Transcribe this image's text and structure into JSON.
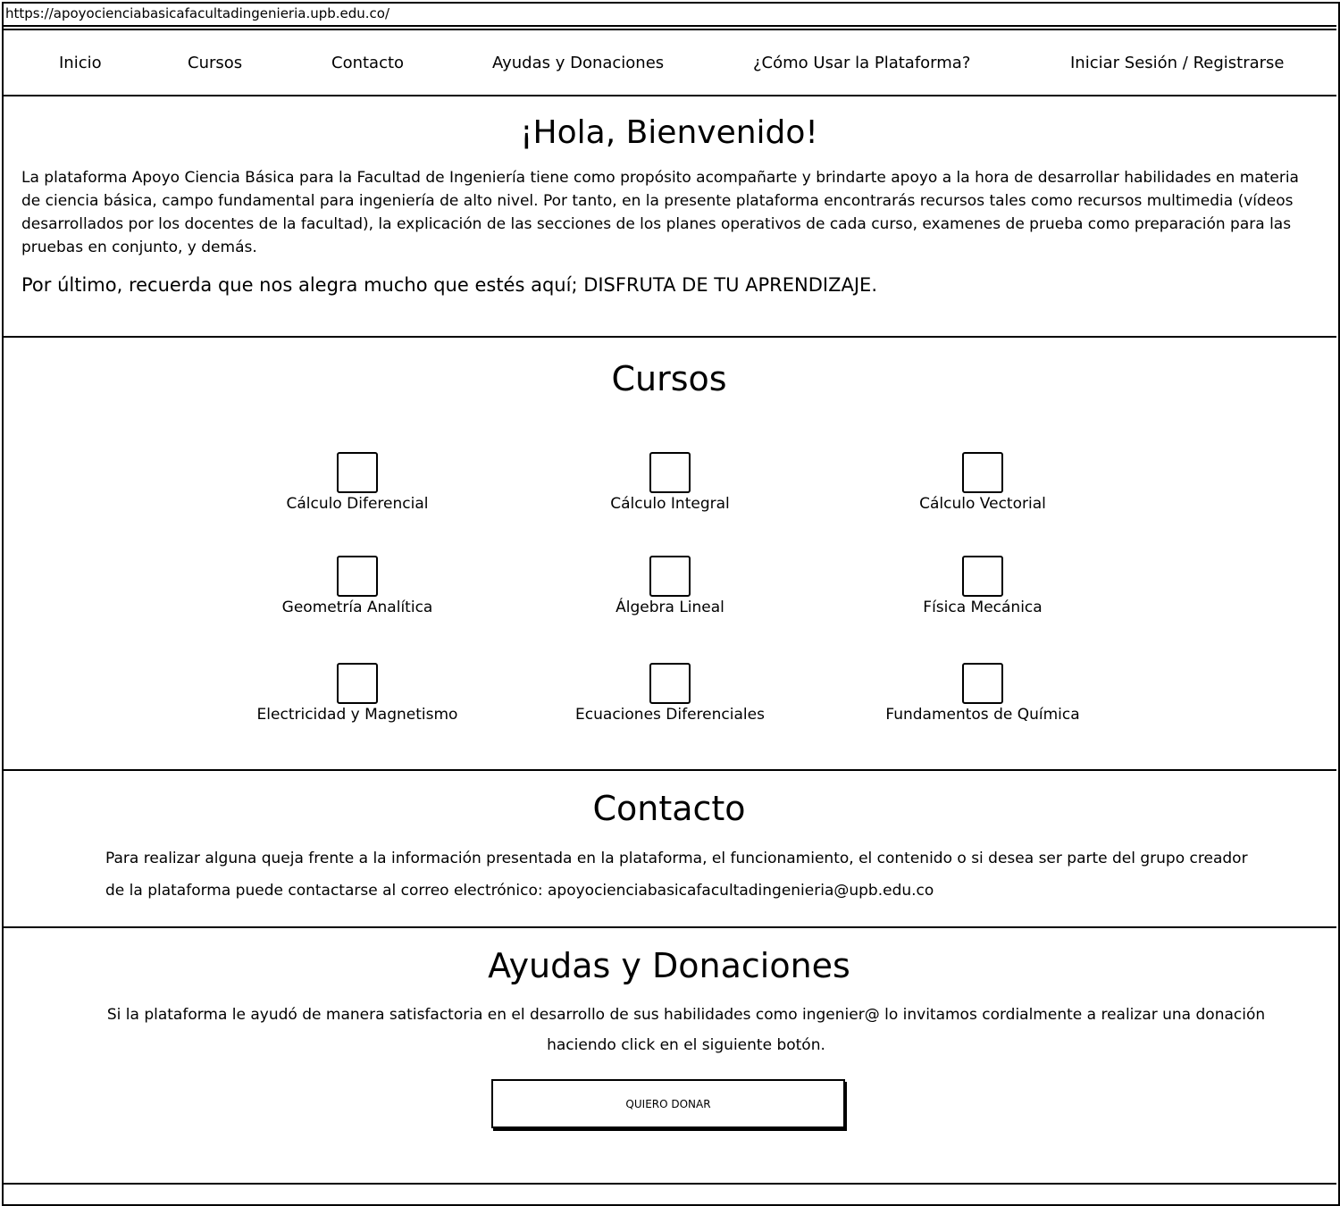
{
  "browser": {
    "url": "https://apoyocienciabasicafacultadingenieria.upb.edu.co/"
  },
  "nav": {
    "items": [
      {
        "label": "Inicio"
      },
      {
        "label": "Cursos"
      },
      {
        "label": "Contacto"
      },
      {
        "label": "Ayudas y Donaciones"
      },
      {
        "label": "¿Cómo Usar la Plataforma?"
      },
      {
        "label": "Iniciar Sesión / Registrarse"
      }
    ]
  },
  "welcome": {
    "title": "¡Hola, Bienvenido!",
    "body": "La plataforma Apoyo Ciencia Básica para la Facultad de Ingeniería tiene como propósito acompañarte y brindarte apoyo a la hora de desarrollar habilidades en materia de ciencia básica, campo fundamental para ingeniería de alto nivel. Por tanto, en la presente plataforma encontrarás recursos tales como recursos multimedia (vídeos desarrollados por los docentes de la facultad), la explicación de las secciones de los planes operativos de cada curso, examenes de prueba como preparación para las pruebas en conjunto, y demás.",
    "closing": "Por último, recuerda que nos alegra mucho que estés aquí; DISFRUTA DE TU APRENDIZAJE."
  },
  "courses": {
    "title": "Cursos",
    "items": [
      {
        "label": "Cálculo Diferencial"
      },
      {
        "label": "Cálculo Integral"
      },
      {
        "label": "Cálculo Vectorial"
      },
      {
        "label": "Geometría Analítica"
      },
      {
        "label": "Álgebra Lineal"
      },
      {
        "label": "Física Mecánica"
      },
      {
        "label": "Electricidad y Magnetismo"
      },
      {
        "label": "Ecuaciones Diferenciales"
      },
      {
        "label": "Fundamentos de Química"
      }
    ]
  },
  "contact": {
    "title": "Contacto",
    "body": "Para realizar alguna queja frente a la información presentada en la plataforma, el funcionamiento, el contenido o si desea ser parte del grupo creador de la plataforma puede contactarse al correo electrónico: apoyocienciabasicafacultadingenieria@upb.edu.co"
  },
  "donations": {
    "title": "Ayudas y Donaciones",
    "body": "Si la plataforma le ayudó de manera satisfactoria en el desarrollo de sus habilidades como ingenier@ lo invitamos cordialmente a realizar una donación haciendo click en el siguiente botón.",
    "button_label": "QUIERO DONAR"
  }
}
